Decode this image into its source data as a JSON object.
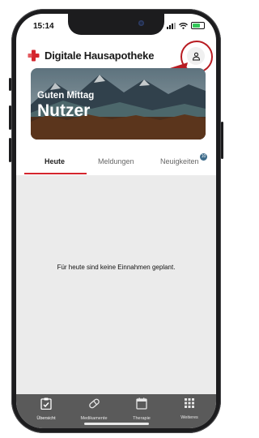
{
  "status_bar": {
    "time": "15:14"
  },
  "app": {
    "name": "Digitale Hausapotheke",
    "brand_color": "#d4262e"
  },
  "profile_button": {
    "icon": "person-icon"
  },
  "hero": {
    "greeting": "Guten Mittag",
    "user_name": "Nutzer"
  },
  "tabs": [
    {
      "label": "Heute",
      "active": true
    },
    {
      "label": "Meldungen",
      "active": false
    },
    {
      "label": "Neuigkeiten",
      "active": false,
      "badge": "10"
    }
  ],
  "content": {
    "empty_message": "Für heute sind keine Einnahmen geplant."
  },
  "bottom_nav": [
    {
      "label": "Übersicht",
      "icon": "clipboard-check-icon",
      "active": true
    },
    {
      "label": "Medikamente",
      "icon": "pill-icon",
      "active": false
    },
    {
      "label": "Therapie",
      "icon": "calendar-icon",
      "active": false
    },
    {
      "label": "Weiteres",
      "icon": "grid-icon",
      "active": false
    }
  ],
  "annotation": {
    "highlight_color": "#b81c22"
  }
}
